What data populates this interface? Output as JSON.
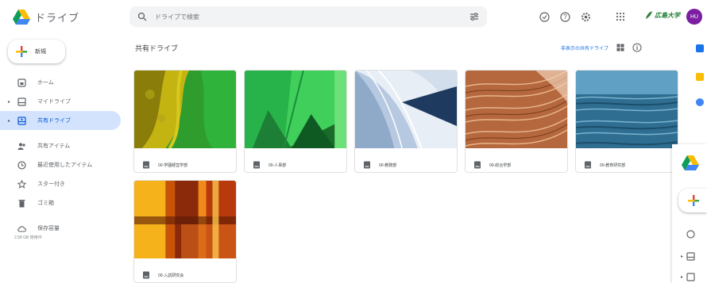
{
  "app": {
    "name": "ドライブ"
  },
  "search": {
    "placeholder": "ドライブで検索"
  },
  "org": {
    "label": "広島大学"
  },
  "user": {
    "initials": "HU"
  },
  "new_button": {
    "label": "新規"
  },
  "nav": {
    "items": [
      {
        "label": "ホーム",
        "icon": "home-icon"
      },
      {
        "label": "マイドライブ",
        "icon": "my-drive-icon"
      },
      {
        "label": "共有ドライブ",
        "icon": "shared-drives-icon",
        "active": true
      },
      {
        "label": "共有アイテム",
        "icon": "shared-with-me-icon"
      },
      {
        "label": "最近使用したアイテム",
        "icon": "recent-icon"
      },
      {
        "label": "スター付き",
        "icon": "starred-icon"
      },
      {
        "label": "ゴミ箱",
        "icon": "trash-icon"
      },
      {
        "label": "保存容量",
        "icon": "cloud-icon"
      }
    ],
    "storage_text": "2.58 GB 使用中"
  },
  "main": {
    "title": "共有ドライブ",
    "hidden_link": "非表示の共有ドライブ"
  },
  "drives": [
    {
      "name": "00-学園経営学部",
      "theme": "yellow-green"
    },
    {
      "name": "00-人事部",
      "theme": "green-fan"
    },
    {
      "name": "00-教務部",
      "theme": "blue-pages"
    },
    {
      "name": "00-総合学部",
      "theme": "copper-lines"
    },
    {
      "name": "00-教育研究部",
      "theme": "blue-water"
    },
    {
      "name": "00-入試研究会",
      "theme": "orange-curtain"
    }
  ],
  "colors": {
    "accent": "#1a73e8",
    "active_nav_bg": "#d3e3fd",
    "active_nav_text": "#0b57d0"
  }
}
